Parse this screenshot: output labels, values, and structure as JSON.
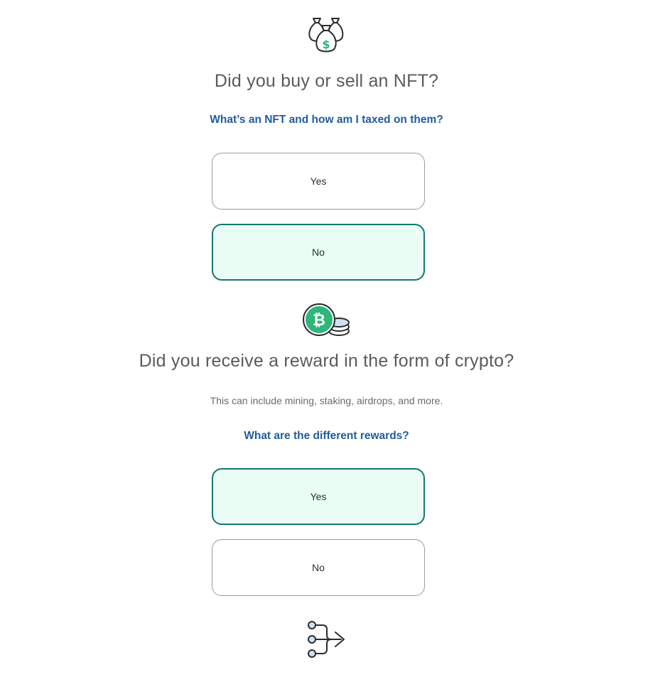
{
  "nft_section": {
    "icon": "money-bags-icon",
    "question": "Did you buy or sell an NFT?",
    "help_link": "What’s an NFT and how am I taxed on them?",
    "options": [
      {
        "label": "Yes",
        "selected": false
      },
      {
        "label": "No",
        "selected": true
      }
    ]
  },
  "reward_section": {
    "icon": "bitcoin-coins-icon",
    "question": "Did you receive a reward in the form of crypto?",
    "subtext": "This can include mining, staking, airdrops, and more.",
    "help_link": "What are the different rewards?",
    "options": [
      {
        "label": "Yes",
        "selected": true
      },
      {
        "label": "No",
        "selected": false
      }
    ]
  },
  "next_section": {
    "icon": "transfer-arrow-icon"
  },
  "colors": {
    "selected_border": "#137a6d",
    "selected_fill": "#eafdf4",
    "link": "#215c9c",
    "accent_green": "#2fb67a",
    "icon_stroke": "#2b2c2e"
  }
}
